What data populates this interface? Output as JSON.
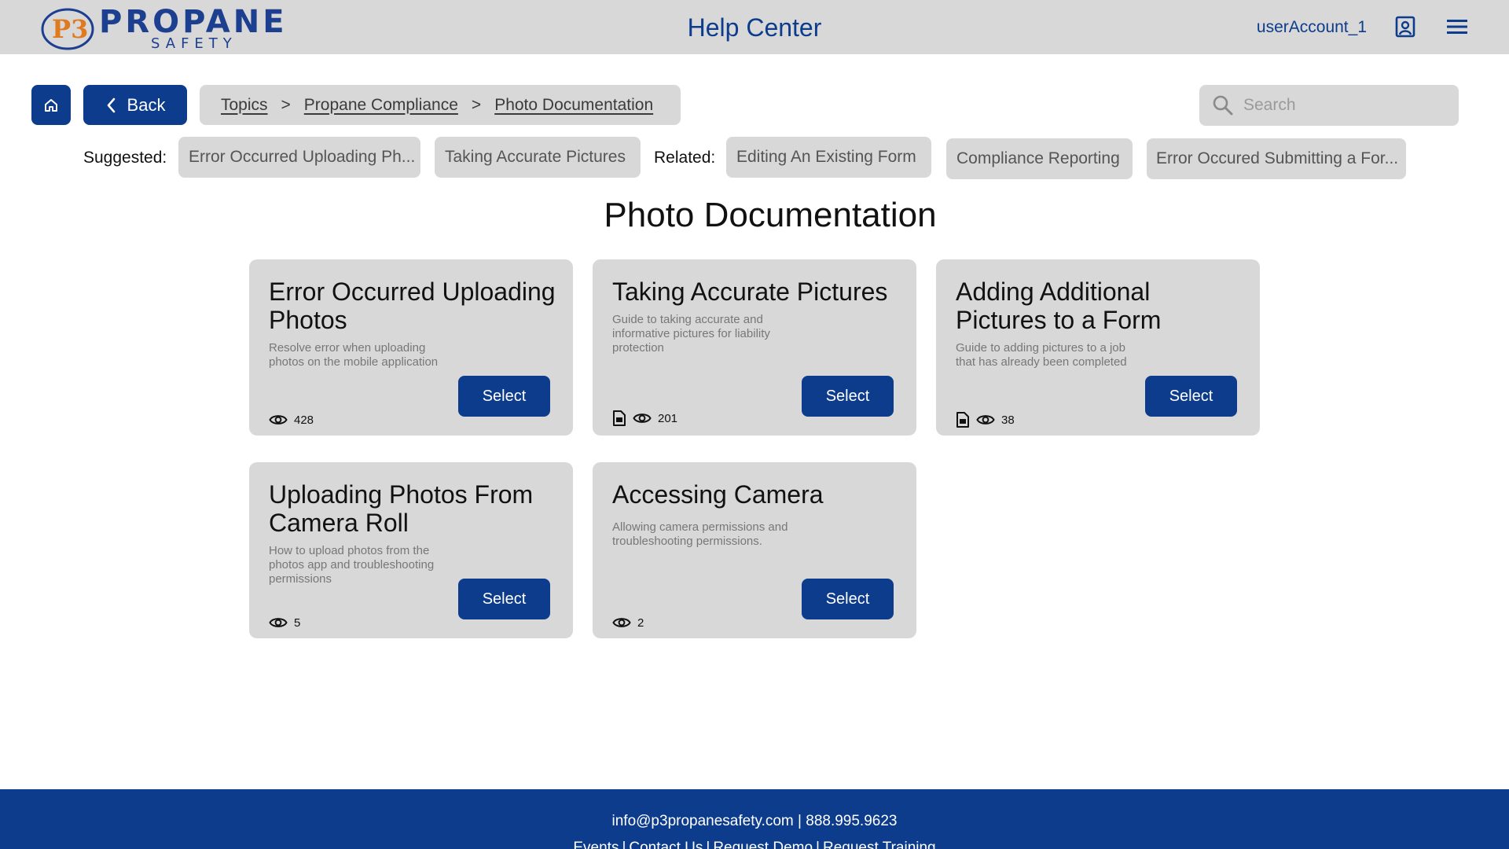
{
  "header": {
    "logo_mark": "P3",
    "logo_text": "PROPANE",
    "logo_sub": "SAFETY",
    "title": "Help Center",
    "user_account": "userAccount_1",
    "user_icon": "user-profile-icon",
    "menu_icon": "hamburger-menu-icon"
  },
  "toolbar": {
    "home_icon": "home-icon",
    "back_label": "Back",
    "breadcrumb": [
      "Topics",
      "Propane Compliance",
      "Photo Documentation"
    ],
    "breadcrumb_separator": ">",
    "search_placeholder": "Search"
  },
  "suggested": {
    "label": "Suggested:",
    "items": [
      "Error Occurred Uploading Ph...",
      "Taking Accurate Pictures"
    ]
  },
  "related": {
    "label": "Related:",
    "items": [
      "Editing An Existing Form",
      "Compliance Reporting",
      "Error Occured Submitting a For..."
    ]
  },
  "main": {
    "title": "Photo Documentation",
    "select_label": "Select",
    "cards": [
      {
        "title": "Error Occurred Uploading Photos",
        "description": "Resolve error when uploading photos on the mobile application",
        "views": "428",
        "has_document": false
      },
      {
        "title": "Taking Accurate Pictures",
        "description": "Guide to taking accurate and informative pictures for liability protection",
        "views": "201",
        "has_document": true
      },
      {
        "title": "Adding Additional Pictures to a Form",
        "description": "Guide to adding pictures to a job that has already been completed",
        "views": "38",
        "has_document": true
      },
      {
        "title": "Uploading Photos From Camera Roll",
        "description": "How to upload photos from the photos app and troubleshooting permissions",
        "views": "5",
        "has_document": false
      },
      {
        "title": "Accessing Camera",
        "description": "Allowing camera permissions and troubleshooting permissions.",
        "views": "2",
        "has_document": false
      }
    ]
  },
  "footer": {
    "contact": "info@p3propanesafety.com | 888.995.9623",
    "links": [
      "Events",
      "Contact Us",
      "Request Demo",
      "Request Training"
    ]
  },
  "colors": {
    "brand_blue": "#0d3c8c",
    "header_gray": "#d8d8d8",
    "logo_orange": "#e07a1f"
  }
}
